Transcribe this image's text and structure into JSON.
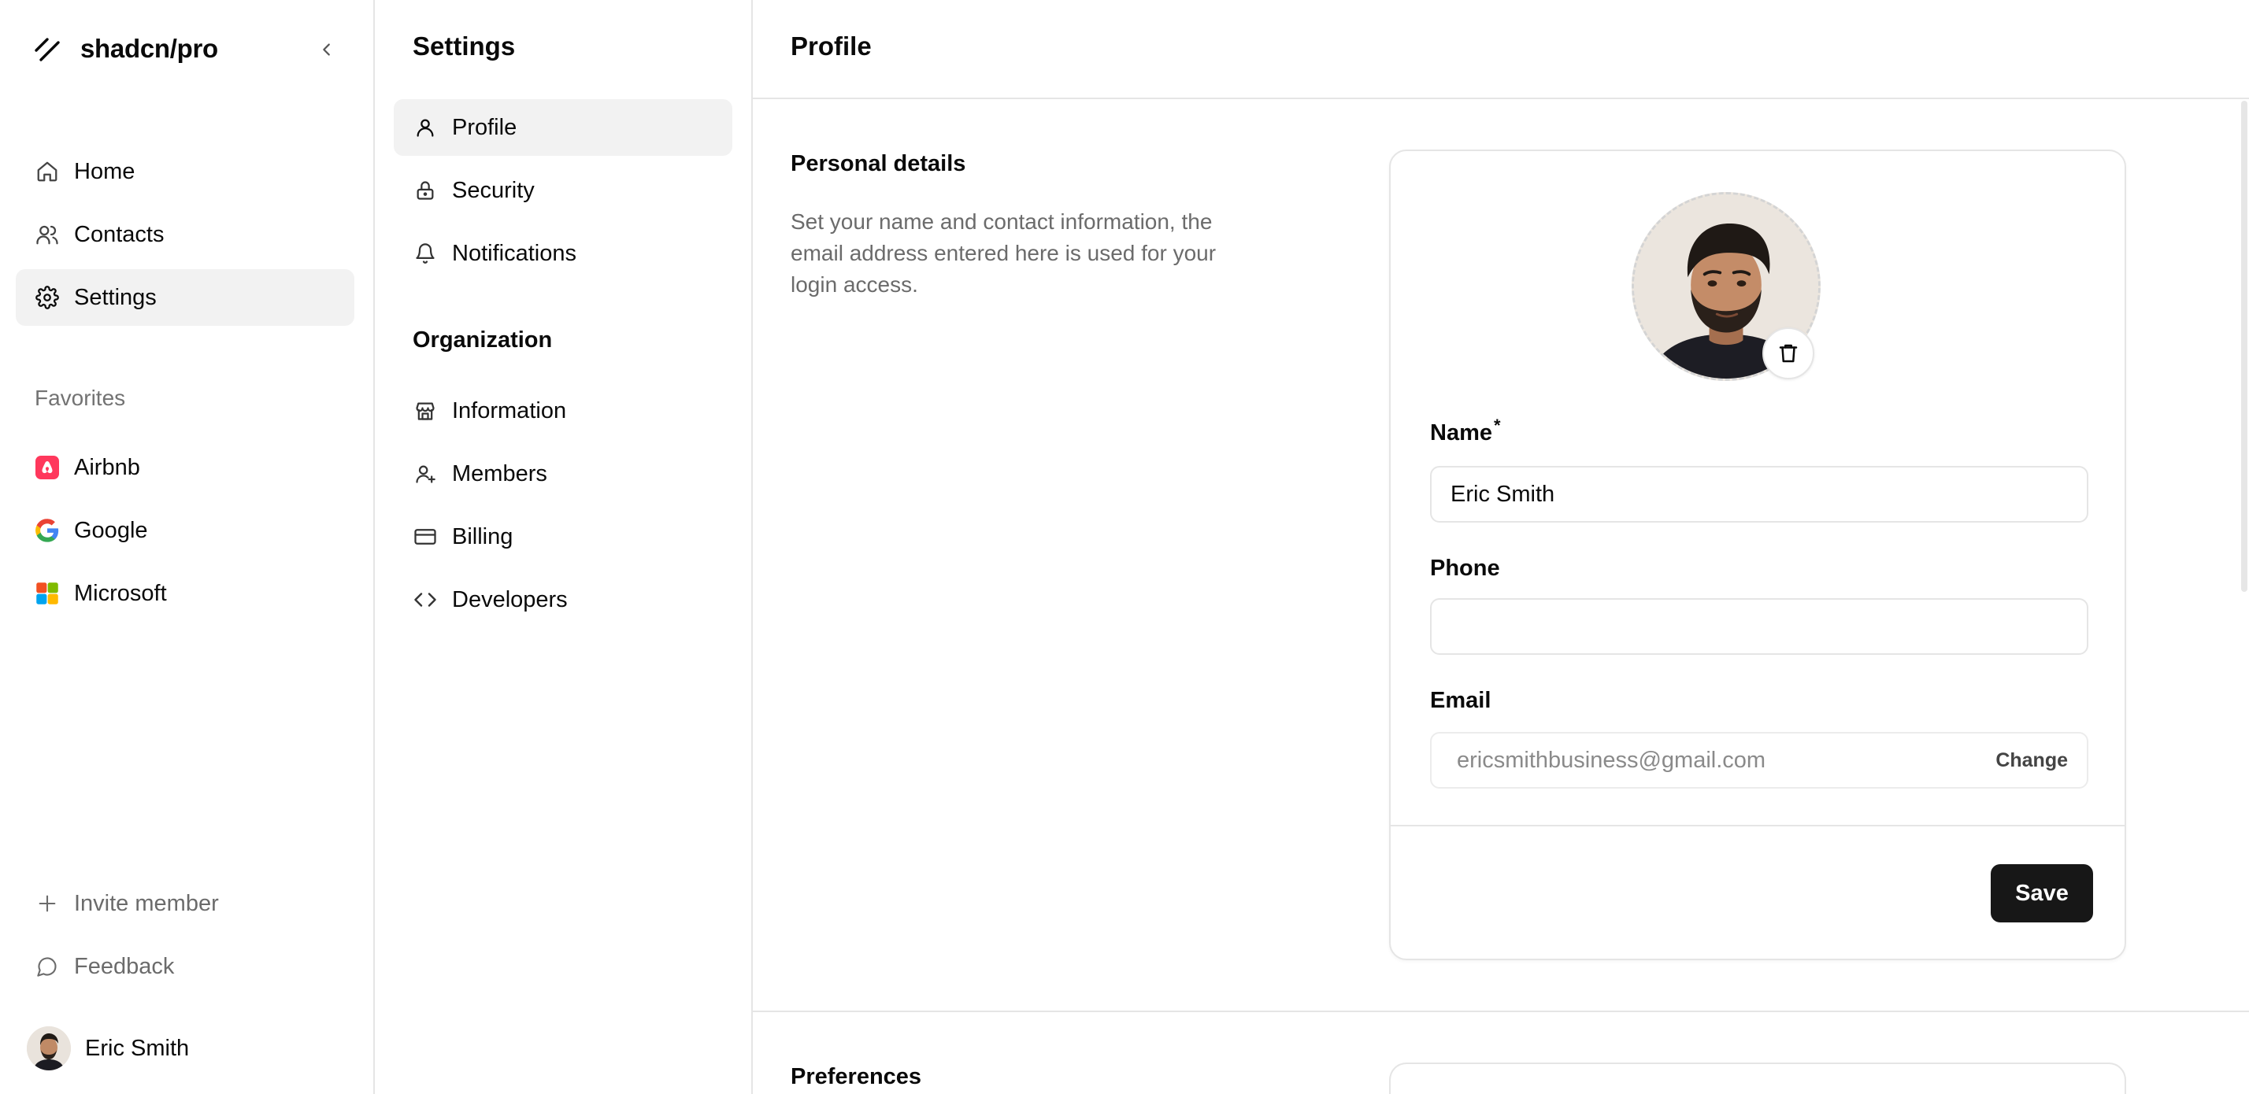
{
  "brand": {
    "name": "shadcn/pro"
  },
  "sidebar": {
    "nav": [
      {
        "label": "Home",
        "icon": "home-icon",
        "active": false
      },
      {
        "label": "Contacts",
        "icon": "users-icon",
        "active": false
      },
      {
        "label": "Settings",
        "icon": "gear-icon",
        "active": true
      }
    ],
    "favorites_label": "Favorites",
    "favorites": [
      {
        "label": "Airbnb",
        "icon": "airbnb-icon",
        "color": "#ff385c"
      },
      {
        "label": "Google",
        "icon": "google-icon"
      },
      {
        "label": "Microsoft",
        "icon": "microsoft-icon"
      }
    ],
    "bottom": [
      {
        "label": "Invite member",
        "icon": "plus-icon"
      },
      {
        "label": "Feedback",
        "icon": "message-icon"
      }
    ],
    "user": {
      "name": "Eric Smith"
    }
  },
  "settings_nav": {
    "title": "Settings",
    "account_items": [
      {
        "label": "Profile",
        "icon": "user-icon",
        "active": true
      },
      {
        "label": "Security",
        "icon": "lock-icon",
        "active": false
      },
      {
        "label": "Notifications",
        "icon": "bell-icon",
        "active": false
      }
    ],
    "organization_label": "Organization",
    "organization_items": [
      {
        "label": "Information",
        "icon": "store-icon"
      },
      {
        "label": "Members",
        "icon": "user-plus-icon"
      },
      {
        "label": "Billing",
        "icon": "credit-card-icon"
      },
      {
        "label": "Developers",
        "icon": "code-icon"
      }
    ]
  },
  "main": {
    "title": "Profile",
    "personal": {
      "heading": "Personal details",
      "description": "Set your name and contact information, the email address entered here is used for your login access.",
      "name_label": "Name",
      "required_mark": "*",
      "name_value": "Eric Smith",
      "phone_label": "Phone",
      "phone_value": "",
      "email_label": "Email",
      "email_value": "ericsmithbusiness@gmail.com",
      "change_label": "Change",
      "save_label": "Save"
    },
    "preferences": {
      "heading": "Preferences"
    }
  },
  "colors": {
    "accent": "#171717",
    "active_bg": "#f2f2f2",
    "border": "#e5e5e5",
    "muted_text": "#737373"
  }
}
